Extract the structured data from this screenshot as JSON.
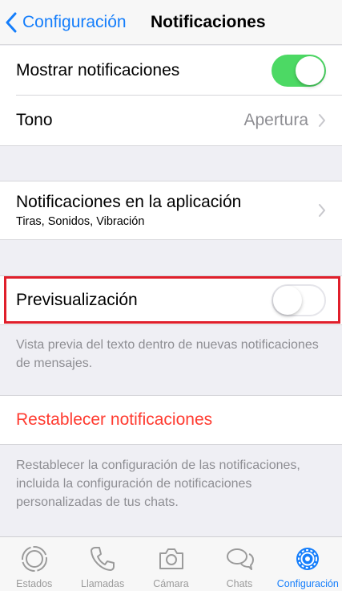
{
  "nav": {
    "back_label": "Configuración",
    "title": "Notificaciones"
  },
  "settings": {
    "show_notifications": {
      "label": "Mostrar notificaciones",
      "enabled": true
    },
    "tone": {
      "label": "Tono",
      "value": "Apertura"
    },
    "in_app": {
      "label": "Notificaciones en la aplicación",
      "subtitle": "Tiras, Sonidos, Vibración"
    },
    "preview": {
      "label": "Previsualización",
      "enabled": false,
      "footer": "Vista previa del texto dentro de nuevas notificaciones de mensajes."
    },
    "reset": {
      "label": "Restablecer notificaciones",
      "footer": "Restablecer la configuración de las notificaciones, incluida la configuración de notificaciones personalizadas de tus chats."
    }
  },
  "tabbar": {
    "tabs": [
      {
        "label": "Estados",
        "icon": "status-icon",
        "active": false
      },
      {
        "label": "Llamadas",
        "icon": "phone-icon",
        "active": false
      },
      {
        "label": "Cámara",
        "icon": "camera-icon",
        "active": false
      },
      {
        "label": "Chats",
        "icon": "chats-icon",
        "active": false
      },
      {
        "label": "Configuración",
        "icon": "gear-icon",
        "active": true
      }
    ]
  },
  "colors": {
    "accent": "#157efb",
    "switch_on": "#4cd964",
    "destructive": "#ff3b30",
    "highlight_border": "#e01f2b",
    "background": "#efeff4"
  }
}
